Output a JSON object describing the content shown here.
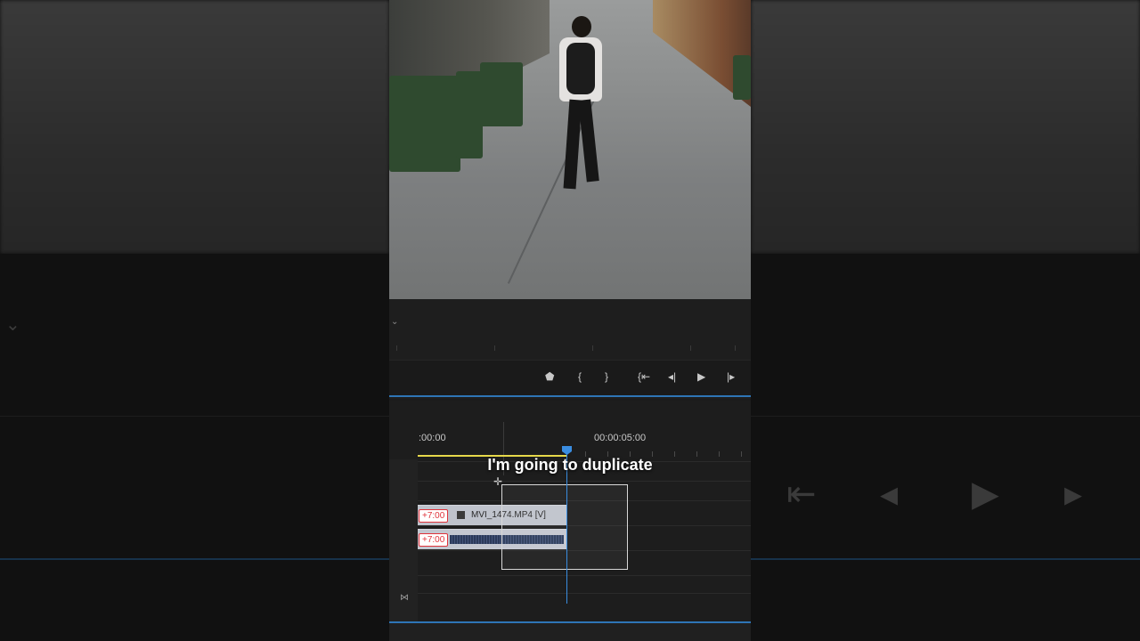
{
  "video": {
    "subtitle": "I'm going to duplicate"
  },
  "program_monitor": {
    "controls": [
      {
        "name": "add-marker-button",
        "icon": "marker-icon",
        "glyph": "⬟"
      },
      {
        "name": "mark-in-button",
        "icon": "mark-in-icon",
        "glyph": "{"
      },
      {
        "name": "mark-out-button",
        "icon": "mark-out-icon",
        "glyph": "}"
      },
      {
        "name": "go-to-in-button",
        "icon": "go-to-in-icon",
        "glyph": "{⇤"
      },
      {
        "name": "step-back-button",
        "icon": "step-back-icon",
        "glyph": "◂|"
      },
      {
        "name": "play-button",
        "icon": "play-icon",
        "glyph": "▶"
      },
      {
        "name": "step-forward-button",
        "icon": "step-forward-icon",
        "glyph": "|▸"
      }
    ]
  },
  "timeline": {
    "timecode_start": ":00:00",
    "timecode_mark": "00:00:05:00",
    "video_clip": {
      "badge": "+7:00",
      "label": "MVI_1474.MP4 [V]"
    },
    "audio_clip": {
      "badge": "+7:00"
    }
  },
  "colors": {
    "accent_blue": "#2e75b6",
    "playhead": "#3a8de0",
    "work_area": "#e6d84a",
    "badge_red": "#e0333b"
  }
}
